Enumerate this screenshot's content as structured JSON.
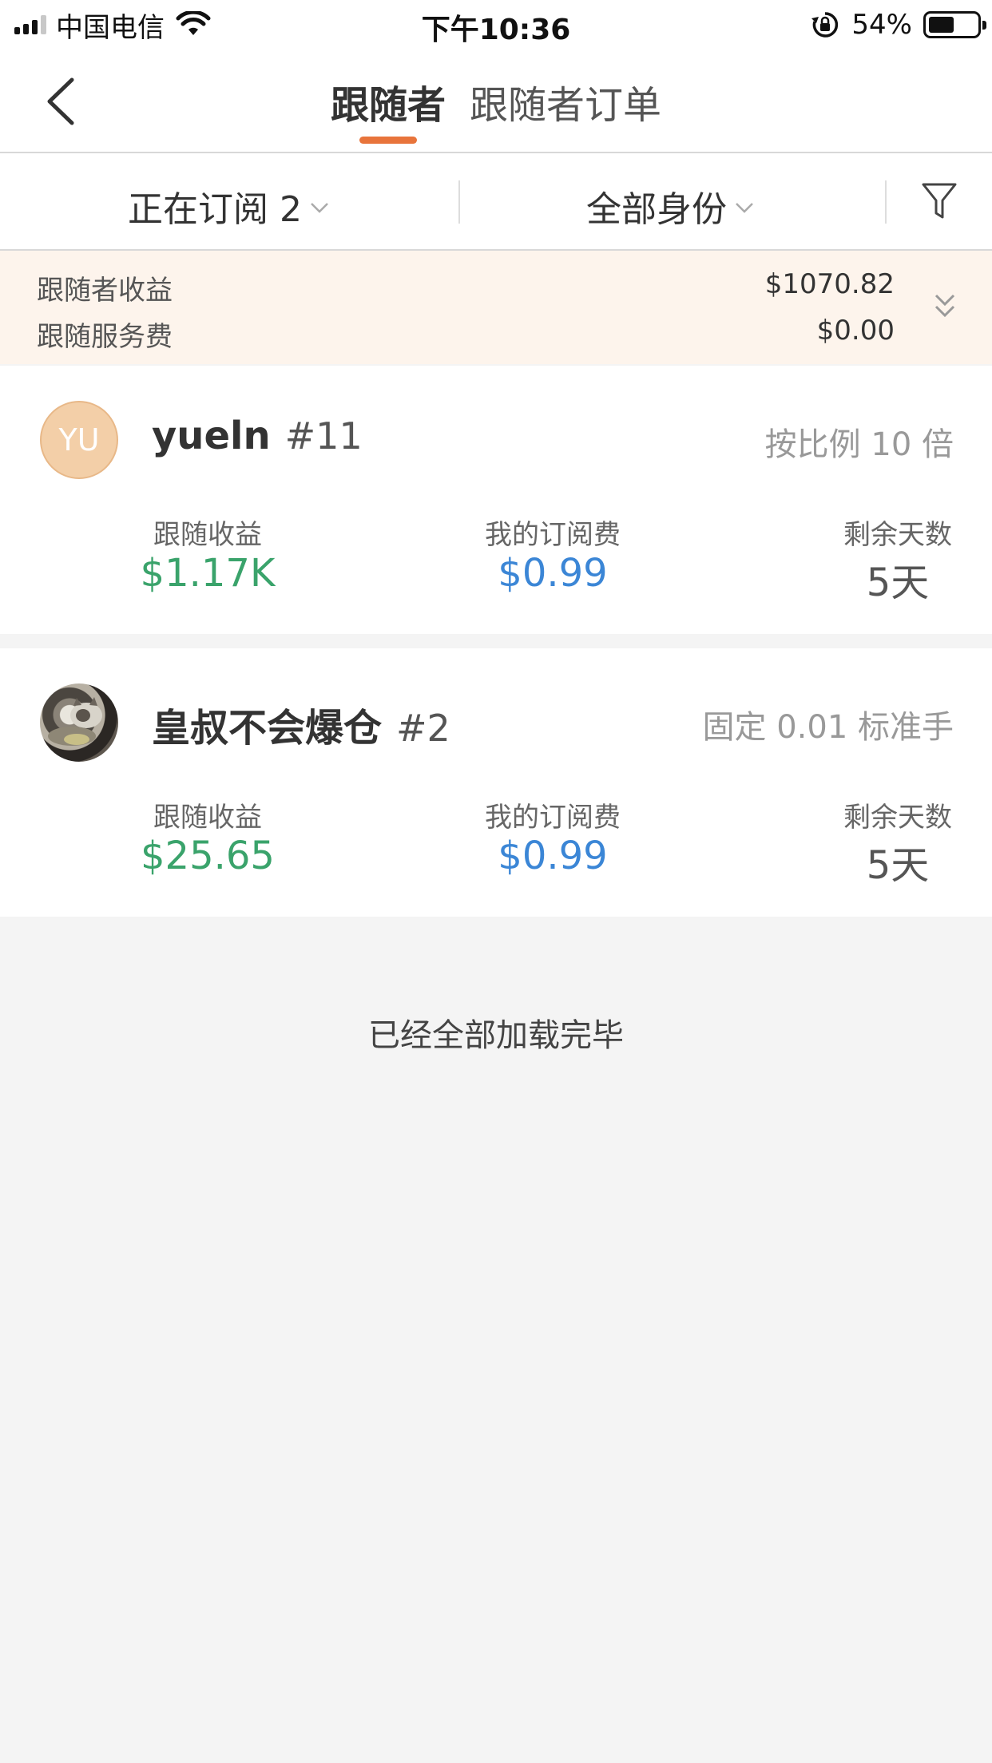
{
  "status_bar": {
    "carrier": "中国电信",
    "time": "下午10:36",
    "battery_percent": "54%",
    "battery_level": 0.54
  },
  "nav": {
    "tabs": [
      {
        "label": "跟随者",
        "active": true
      },
      {
        "label": "跟随者订单",
        "active": false
      }
    ],
    "accent_color": "#e8743b"
  },
  "filters": {
    "subscription": "正在订阅 2",
    "identity": "全部身份"
  },
  "summary": {
    "rows": [
      {
        "label": "跟随者收益",
        "value": "$1070.82"
      },
      {
        "label": "跟随服务费",
        "value": "$0.00"
      }
    ]
  },
  "followers": [
    {
      "avatar_text": "YU",
      "name": "yueln",
      "number": "#11",
      "mode": "按比例 10 倍",
      "stats": [
        {
          "label": "跟随收益",
          "value": "$1.17K",
          "color": "#3aa36b"
        },
        {
          "label": "我的订阅费",
          "value": "$0.99",
          "color": "#3b86d6"
        },
        {
          "label": "剩余天数",
          "value": "5天",
          "color": "#555555"
        }
      ]
    },
    {
      "avatar_text": "",
      "name": "皇叔不会爆仓",
      "number": "#2",
      "mode": "固定 0.01 标准手",
      "stats": [
        {
          "label": "跟随收益",
          "value": "$25.65",
          "color": "#3aa36b"
        },
        {
          "label": "我的订阅费",
          "value": "$0.99",
          "color": "#3b86d6"
        },
        {
          "label": "剩余天数",
          "value": "5天",
          "color": "#555555"
        }
      ]
    }
  ],
  "footer": {
    "text": "已经全部加载完毕"
  }
}
